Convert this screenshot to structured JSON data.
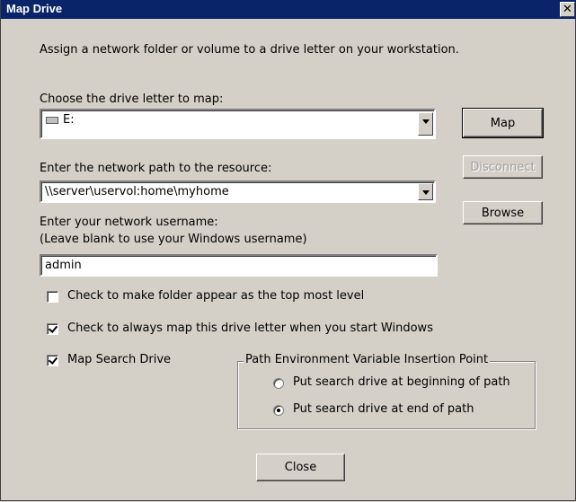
{
  "window": {
    "title": "Map Drive"
  },
  "intro": "Assign a network folder or volume to a drive letter on your workstation.",
  "drive": {
    "label": "Choose the drive letter to map:",
    "value": "E:"
  },
  "path": {
    "label": "Enter the network path to the resource:",
    "value": "\\\\server\\uservol:home\\myhome"
  },
  "username": {
    "label_line1": "Enter your network username:",
    "label_line2": "(Leave blank to use your Windows username)",
    "value": "admin"
  },
  "options": {
    "top_level": {
      "label": "Check to make folder appear as the top most level",
      "checked": false
    },
    "always_map": {
      "label": "Check to always map this drive letter when you start Windows",
      "checked": true
    },
    "search_drive": {
      "label": "Map Search Drive",
      "checked": true
    }
  },
  "insertion_point": {
    "title": "Path Environment Variable Insertion Point",
    "beginning": {
      "label": "Put search drive at beginning of path",
      "selected": false
    },
    "end": {
      "label": "Put search drive at end of path",
      "selected": true
    }
  },
  "buttons": {
    "map": "Map",
    "disconnect": "Disconnect",
    "browse": "Browse",
    "close": "Close"
  },
  "icons": {
    "drive": "drive-icon",
    "close": "close-icon",
    "dropdown": "chevron-down-icon"
  },
  "colors": {
    "titlebar": "#0a246a",
    "face": "#d4d0c8"
  }
}
